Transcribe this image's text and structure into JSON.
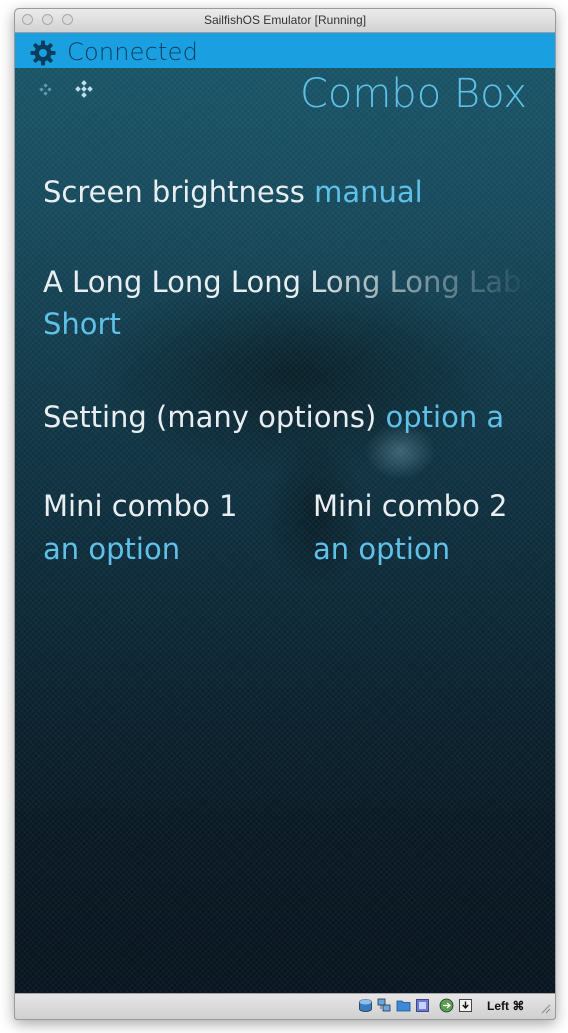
{
  "window": {
    "title": "SailfishOS Emulator [Running]"
  },
  "status": {
    "text": "Connected",
    "accent": "#1aa0e0"
  },
  "page": {
    "title": "Combo Box"
  },
  "combos": [
    {
      "label": "Screen brightness",
      "value": "manual"
    },
    {
      "label": "A Long Long Long Long Long Label",
      "value": "Short"
    },
    {
      "label": "Setting (many options)",
      "value": "option a"
    }
  ],
  "mini_combos": [
    {
      "label": "Mini combo 1",
      "value": "an option"
    },
    {
      "label": "Mini combo 2",
      "value": "an option"
    }
  ],
  "statusbar": {
    "host_key": "Left ⌘",
    "icons": [
      "hard-disk-icon",
      "network-icon",
      "shared-folder-icon",
      "display-icon",
      "usb-icon",
      "mouse-integration-icon"
    ]
  },
  "colors": {
    "label": "#e9eef1",
    "value": "#5fc0e8",
    "title": "#5fc0e8"
  }
}
